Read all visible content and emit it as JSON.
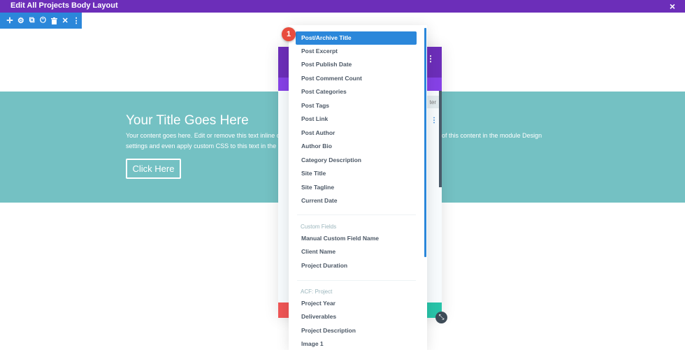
{
  "topbar": {
    "title": "Edit All Projects Body Layout",
    "close_icon": "×"
  },
  "row_toolbar": {
    "icons": [
      {
        "name": "move-icon",
        "glyph": "✛"
      },
      {
        "name": "gear-icon",
        "glyph": "⚙"
      },
      {
        "name": "duplicate-icon",
        "glyph": "⧉"
      },
      {
        "name": "power-icon",
        "glyph": "⏻"
      },
      {
        "name": "trash-icon",
        "glyph": "🗑"
      },
      {
        "name": "close-icon",
        "glyph": "✕"
      },
      {
        "name": "more-icon",
        "glyph": "⋮"
      }
    ]
  },
  "hero": {
    "title": "Your Title Goes Here",
    "text_line1": "Your content goes here. Edit or remove this text inline or in",
    "text_line2": "settings and even apply custom CSS to this text in the mod",
    "text_right": "of this content in the module Design",
    "button_label": "Click Here"
  },
  "modal": {
    "filter_label": "ter",
    "more_icon": "⋮",
    "dots_icon": "⋮"
  },
  "badge": {
    "number": "1"
  },
  "dropdown": {
    "items": [
      "Post/Archive Title",
      "Post Excerpt",
      "Post Publish Date",
      "Post Comment Count",
      "Post Categories",
      "Post Tags",
      "Post Link",
      "Post Author",
      "Author Bio",
      "Category Description",
      "Site Title",
      "Site Tagline",
      "Current Date"
    ],
    "selected": "Post/Archive Title",
    "groups": [
      {
        "label": "Custom Fields",
        "items": [
          "Manual Custom Field Name",
          "Client Name",
          "Project Duration"
        ]
      },
      {
        "label": "ACF: Project",
        "items": [
          "Project Year",
          "Deliverables",
          "Project Description",
          "Image 1"
        ]
      }
    ]
  },
  "colors": {
    "purple": "#6c2eb9",
    "blue": "#2b87da",
    "teal": "#74c1c3",
    "red": "#ef5555",
    "green": "#29c4a9"
  }
}
